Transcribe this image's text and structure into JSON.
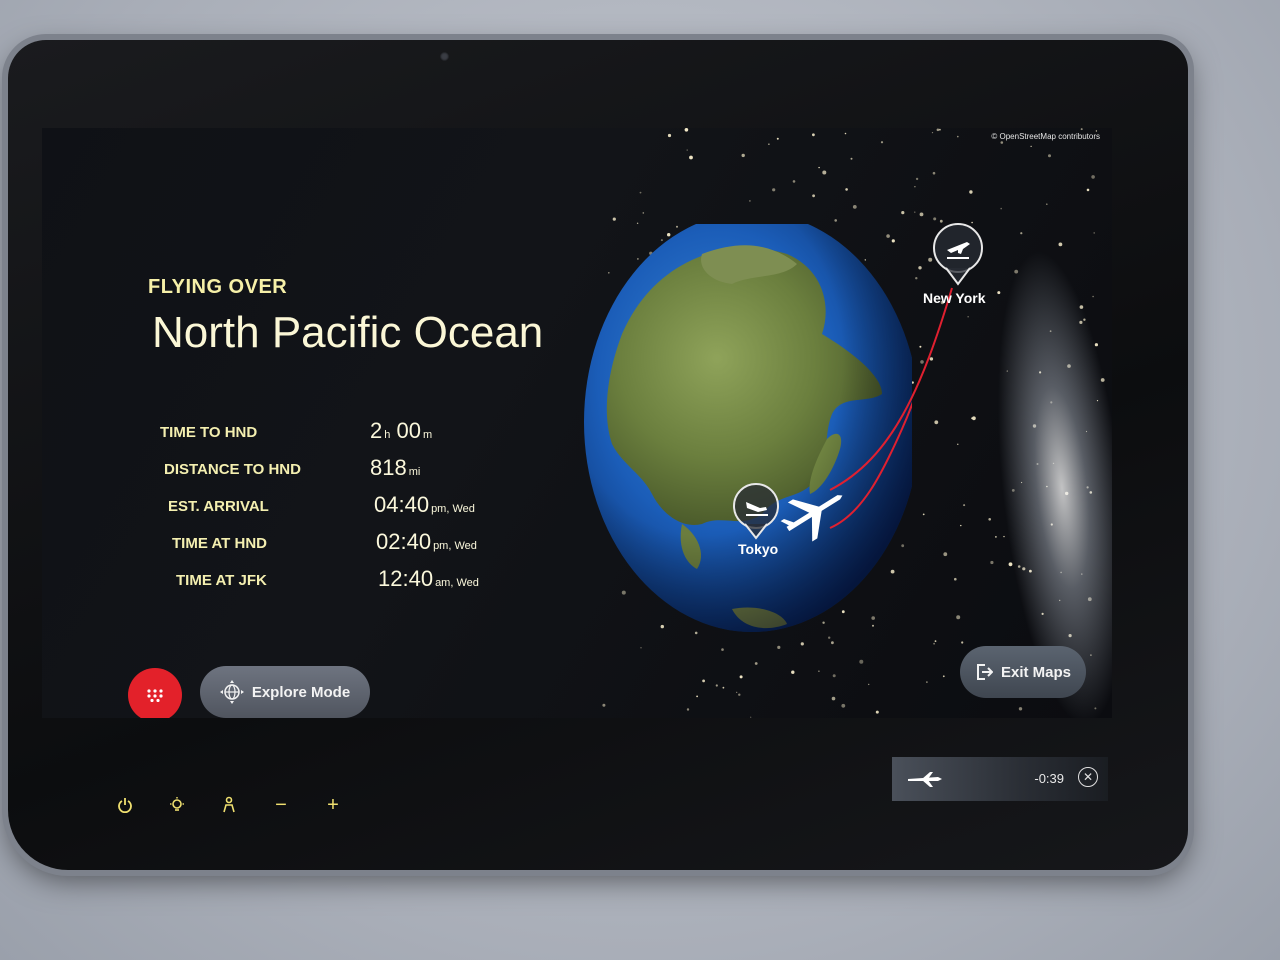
{
  "map": {
    "attribution": "© OpenStreetMap contributors",
    "flying_over_label": "FLYING OVER",
    "location": "North Pacific Ocean",
    "origin_city": "New York",
    "destination_city": "Tokyo"
  },
  "stats": [
    {
      "label": "TIME TO HND",
      "value_a": "2",
      "unit_a": "h",
      "value_b": "00",
      "unit_b": "m"
    },
    {
      "label": "DISTANCE TO HND",
      "value_a": "818",
      "unit_a": "mi",
      "value_b": "",
      "unit_b": ""
    },
    {
      "label": "EST. ARRIVAL",
      "value_a": "04:40",
      "unit_a": "pm, Wed",
      "value_b": "",
      "unit_b": ""
    },
    {
      "label": "TIME AT HND",
      "value_a": "02:40",
      "unit_a": "pm, Wed",
      "value_b": "",
      "unit_b": ""
    },
    {
      "label": "TIME AT JFK",
      "value_a": "12:40",
      "unit_a": "am, Wed",
      "value_b": "",
      "unit_b": ""
    }
  ],
  "buttons": {
    "explore_mode": "Explore Mode",
    "exit_maps": "Exit Maps"
  },
  "mini_player": {
    "time_remaining": "-0:39"
  },
  "hardware_controls": {
    "minus": "−",
    "plus": "+"
  },
  "colors": {
    "accent_red": "#e3212a",
    "label_yellow": "#f4efb0",
    "route_red": "#e02030"
  },
  "icons": [
    "menu-grid-icon",
    "globe-move-icon",
    "exit-icon",
    "plane-landing-icon",
    "plane-takeoff-icon",
    "airplane-icon",
    "power-icon",
    "light-icon",
    "attendant-icon",
    "close-icon"
  ]
}
